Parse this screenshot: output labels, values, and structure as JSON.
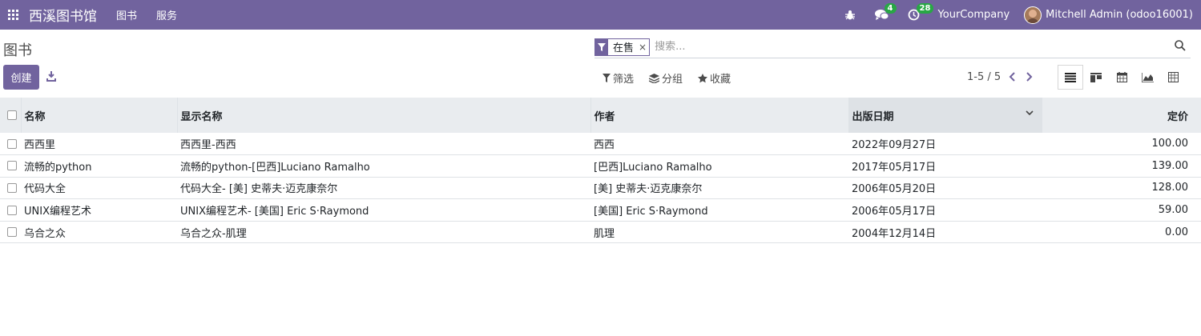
{
  "navbar": {
    "app_name": "西溪图书馆",
    "menus": [
      "图书",
      "服务"
    ],
    "messages_count": "4",
    "activities_count": "28",
    "company": "YourCompany",
    "user": "Mitchell Admin (odoo16001)"
  },
  "control_panel": {
    "title": "图书",
    "facet_value": "在售",
    "facet_remove": "×",
    "search_placeholder": "搜索...",
    "create_label": "创建",
    "filters_label": "筛选",
    "groupby_label": "分组",
    "favorites_label": "收藏",
    "pager_value": "1-5 / 5"
  },
  "table": {
    "columns": [
      "名称",
      "显示名称",
      "作者",
      "出版日期",
      "定价"
    ],
    "rows": [
      {
        "name": "西西里",
        "display_name": "西西里-西西",
        "author": "西西",
        "date": "2022年09月27日",
        "price": "100.00"
      },
      {
        "name": "流畅的python",
        "display_name": "流畅的python-[巴西]Luciano Ramalho",
        "author": "[巴西]Luciano Ramalho",
        "date": "2017年05月17日",
        "price": "139.00"
      },
      {
        "name": "代码大全",
        "display_name": "代码大全- [美] 史蒂夫·迈克康奈尔",
        "author": "[美] 史蒂夫·迈克康奈尔",
        "date": "2006年05月20日",
        "price": "128.00"
      },
      {
        "name": "UNIX编程艺术",
        "display_name": "UNIX编程艺术- [美国] Eric S·Raymond",
        "author": "[美国] Eric S·Raymond",
        "date": "2006年05月17日",
        "price": "59.00"
      },
      {
        "name": "乌合之众",
        "display_name": "乌合之众-肌理",
        "author": "肌理",
        "date": "2004年12月14日",
        "price": "0.00"
      }
    ]
  },
  "colors": {
    "brand": "#71639e",
    "badge": "#28a745"
  },
  "icons": [
    "apps-grid-icon",
    "bug-icon",
    "chat-icon",
    "clock-icon",
    "filter-icon",
    "search-icon",
    "download-icon",
    "layers-icon",
    "star-icon",
    "chevron-left-icon",
    "chevron-right-icon",
    "list-view-icon",
    "kanban-view-icon",
    "calendar-view-icon",
    "graph-view-icon",
    "pivot-view-icon",
    "chevron-down-icon"
  ]
}
